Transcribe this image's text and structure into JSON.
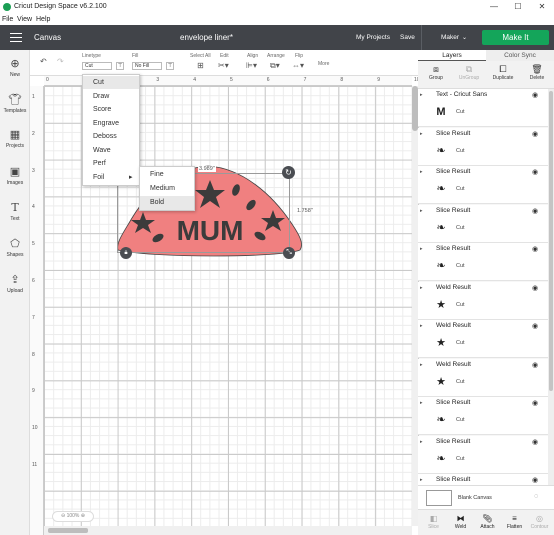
{
  "window": {
    "title": "Cricut Design Space  v6.2.100",
    "minimize": "—",
    "maximize": "☐",
    "close": "✕"
  },
  "menubar": [
    "File",
    "View",
    "Help"
  ],
  "header": {
    "section": "Canvas",
    "project_name": "envelope liner*",
    "my_projects": "My Projects",
    "save": "Save",
    "machine": "Maker",
    "make_it": "Make It",
    "accent": "#14a55a"
  },
  "sidebar": [
    {
      "label": "New",
      "icon": "plus-icon"
    },
    {
      "label": "Templates",
      "icon": "shirt-icon"
    },
    {
      "label": "Projects",
      "icon": "projects-icon"
    },
    {
      "label": "Images",
      "icon": "image-icon"
    },
    {
      "label": "Text",
      "icon": "text-icon"
    },
    {
      "label": "Shapes",
      "icon": "shapes-icon"
    },
    {
      "label": "Upload",
      "icon": "upload-icon"
    }
  ],
  "toolbar": {
    "linetype_label": "Linetype",
    "linetype_value": "Cut",
    "fill_label": "Fill",
    "fill_value": "No Fill",
    "select_all": "Select All",
    "edit": "Edit",
    "align": "Align",
    "arrange": "Arrange",
    "flip": "Flip",
    "more": "More"
  },
  "ruler_top": [
    "0",
    "1",
    "2",
    "3",
    "4",
    "5",
    "6",
    "7",
    "8",
    "9",
    "10"
  ],
  "ruler_left": [
    "1",
    "2",
    "3",
    "4",
    "5",
    "6",
    "7",
    "8",
    "9",
    "10",
    "11"
  ],
  "linetype_menu": {
    "items": [
      "Cut",
      "Draw",
      "Score",
      "Engrave",
      "Deboss",
      "Wave",
      "Perf",
      "Foil"
    ],
    "selected": "Cut",
    "submenu_arrow": "▸"
  },
  "foil_menu": {
    "items": [
      "Fine",
      "Medium",
      "Bold"
    ],
    "selected": "Bold"
  },
  "design": {
    "text": "MUM",
    "width_label": "3.989\"",
    "height_label": "1.758\"",
    "fill_color": "#f08080",
    "shape_color": "#3b3b3b"
  },
  "zoom": "100%",
  "panel": {
    "tabs": [
      "Layers",
      "Color Sync"
    ],
    "actions": [
      {
        "label": "Group",
        "enabled": true
      },
      {
        "label": "UnGroup",
        "enabled": false
      },
      {
        "label": "Duplicate",
        "enabled": true
      },
      {
        "label": "Delete",
        "enabled": true
      }
    ],
    "layers": [
      {
        "title": "Text - Cricut Sans",
        "op": "Cut",
        "thumb": "M",
        "icon": "letter-m-icon"
      },
      {
        "title": "Slice Result",
        "op": "Cut",
        "thumb": "leaf",
        "icon": "leaf-icon"
      },
      {
        "title": "Slice Result",
        "op": "Cut",
        "thumb": "leaf",
        "icon": "leaf-icon"
      },
      {
        "title": "Slice Result",
        "op": "Cut",
        "thumb": "leaf",
        "icon": "leaf-icon"
      },
      {
        "title": "Slice Result",
        "op": "Cut",
        "thumb": "leaf",
        "icon": "leaf-icon"
      },
      {
        "title": "Weld Result",
        "op": "Cut",
        "thumb": "star",
        "icon": "star-icon"
      },
      {
        "title": "Weld Result",
        "op": "Cut",
        "thumb": "star",
        "icon": "star-icon"
      },
      {
        "title": "Weld Result",
        "op": "Cut",
        "thumb": "star",
        "icon": "star-icon"
      },
      {
        "title": "Slice Result",
        "op": "Cut",
        "thumb": "leaf",
        "icon": "leaf-icon"
      },
      {
        "title": "Slice Result",
        "op": "Cut",
        "thumb": "leaf",
        "icon": "leaf-icon"
      },
      {
        "title": "Slice Result",
        "op": "",
        "thumb": "",
        "icon": "leaf-icon"
      }
    ],
    "blank_canvas": "Blank Canvas",
    "bottom_actions": [
      {
        "label": "Slice",
        "enabled": false
      },
      {
        "label": "Weld",
        "enabled": true
      },
      {
        "label": "Attach",
        "enabled": true
      },
      {
        "label": "Flatten",
        "enabled": true
      },
      {
        "label": "Contour",
        "enabled": false
      }
    ]
  }
}
